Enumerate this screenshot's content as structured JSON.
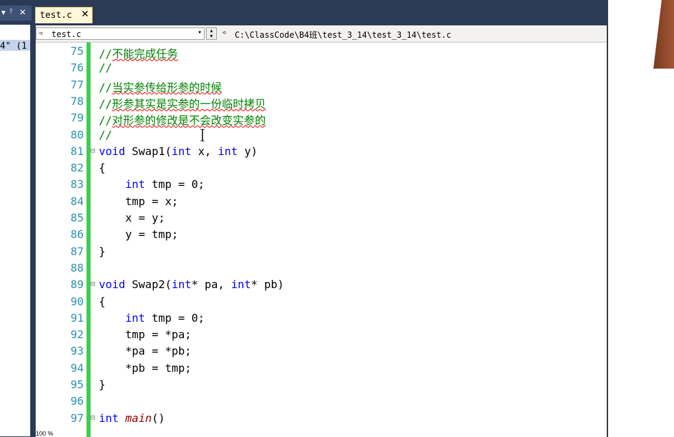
{
  "left_panel": {
    "title_controls": [
      "▾",
      "📌",
      "✕"
    ],
    "content_text": "4\" (1"
  },
  "tab": {
    "label": "test.c",
    "close": "✕"
  },
  "navbar": {
    "file_combo": "test.c",
    "path_combo": "C:\\ClassCode\\B4班\\test_3_14\\test_3_14\\test.c"
  },
  "code_lines": [
    {
      "n": "75",
      "text": "//不能完成任务",
      "type": "comment"
    },
    {
      "n": "76",
      "text": "//",
      "type": "comment"
    },
    {
      "n": "77",
      "text": "//当实参传给形参的时候",
      "type": "comment"
    },
    {
      "n": "78",
      "text": "//形参其实是实参的一份临时拷贝",
      "type": "comment"
    },
    {
      "n": "79",
      "text": "//对形参的修改是不会改变实参的",
      "type": "comment"
    },
    {
      "n": "80",
      "text": "//",
      "type": "comment"
    },
    {
      "n": "81",
      "text": "void Swap1(int x, int y)",
      "type": "code",
      "fold": "⊟"
    },
    {
      "n": "82",
      "text": "{",
      "type": "code"
    },
    {
      "n": "83",
      "text": "    int tmp = 0;",
      "type": "code"
    },
    {
      "n": "84",
      "text": "    tmp = x;",
      "type": "code"
    },
    {
      "n": "85",
      "text": "    x = y;",
      "type": "code"
    },
    {
      "n": "86",
      "text": "    y = tmp;",
      "type": "code"
    },
    {
      "n": "87",
      "text": "}",
      "type": "code"
    },
    {
      "n": "88",
      "text": "",
      "type": "code"
    },
    {
      "n": "89",
      "text": "void Swap2(int* pa, int* pb)",
      "type": "code",
      "fold": "⊟"
    },
    {
      "n": "90",
      "text": "{",
      "type": "code"
    },
    {
      "n": "91",
      "text": "    int tmp = 0;",
      "type": "code"
    },
    {
      "n": "92",
      "text": "    tmp = *pa;",
      "type": "code"
    },
    {
      "n": "93",
      "text": "    *pa = *pb;",
      "type": "code"
    },
    {
      "n": "94",
      "text": "    *pb = tmp;",
      "type": "code"
    },
    {
      "n": "95",
      "text": "}",
      "type": "code"
    },
    {
      "n": "96",
      "text": "",
      "type": "code"
    },
    {
      "n": "97",
      "text": "int main()",
      "type": "code",
      "fold": "⊟"
    }
  ],
  "status": {
    "zoom": "100 %"
  },
  "colors": {
    "frame": "#2b3a55",
    "comment": "#008000",
    "keyword": "#0000ff",
    "line_number": "#2b91af",
    "change_bar": "#3ccf4e"
  }
}
